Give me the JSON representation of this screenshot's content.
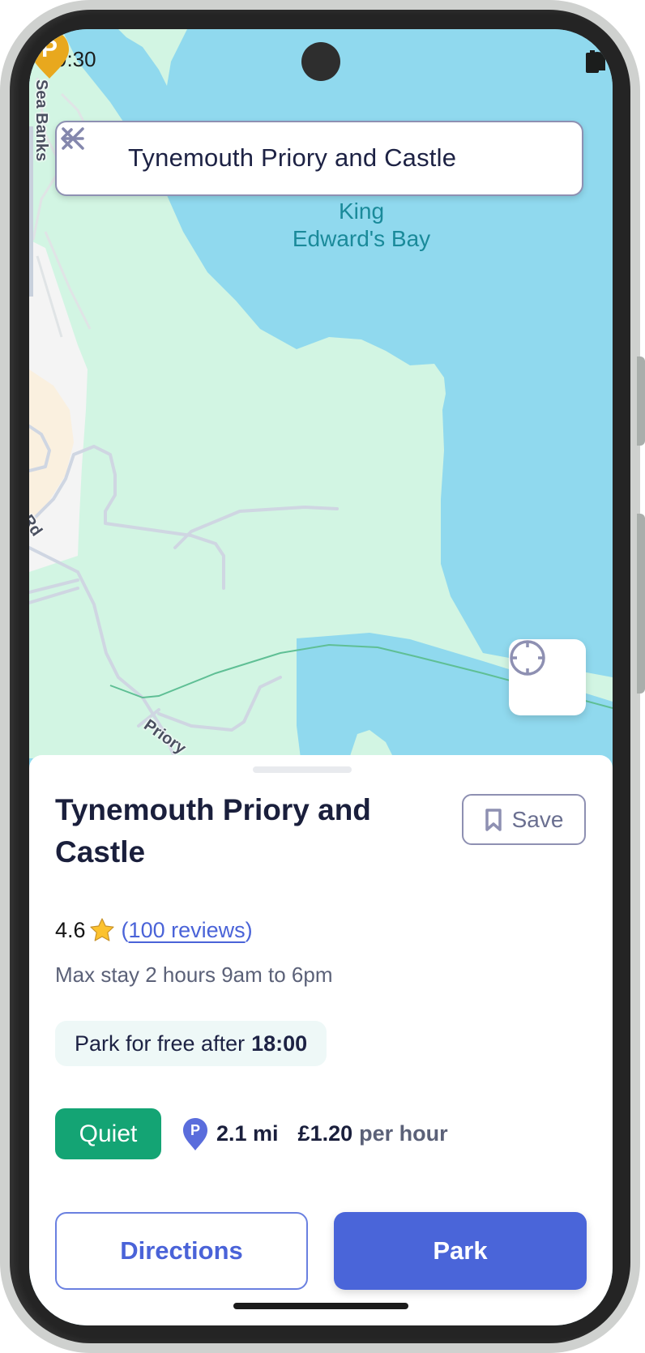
{
  "status_bar": {
    "time": "9:30",
    "icons": [
      "wifi-icon",
      "signal-icon",
      "battery-icon"
    ]
  },
  "search": {
    "value": "Tynemouth Priory and Castle",
    "back_icon": "arrow-left-icon",
    "clear_icon": "close-icon"
  },
  "map": {
    "water_label_line1": "King",
    "water_label_line2": "Edward's Bay",
    "road_labels": [
      "Sea Banks",
      "Pier Rd",
      "Priory"
    ],
    "marker": {
      "icon": "parking-pin-icon",
      "letter": "P"
    },
    "locate_icon": "crosshair-icon",
    "colors": {
      "water": "#90d9ee",
      "park": "#d2f5e3",
      "marker": "#e8a81e"
    }
  },
  "place": {
    "title": "Tynemouth Priory and Castle",
    "save_label": "Save",
    "rating": "4.6",
    "reviews": "100 reviews",
    "max_stay": "Max stay 2 hours 9am to 6pm",
    "free_after_prefix": "Park for free after",
    "free_after_time": "18:00",
    "busyness": "Quiet",
    "distance_icon_letter": "P",
    "distance": "2.1 mi",
    "price": "£1.20",
    "price_unit": "per hour"
  },
  "actions": {
    "directions_label": "Directions",
    "park_label": "Park"
  },
  "colors": {
    "accent": "#4a65d9",
    "quiet_badge": "#14a474",
    "text_primary": "#1a1f3c",
    "text_secondary": "#5b6178"
  }
}
